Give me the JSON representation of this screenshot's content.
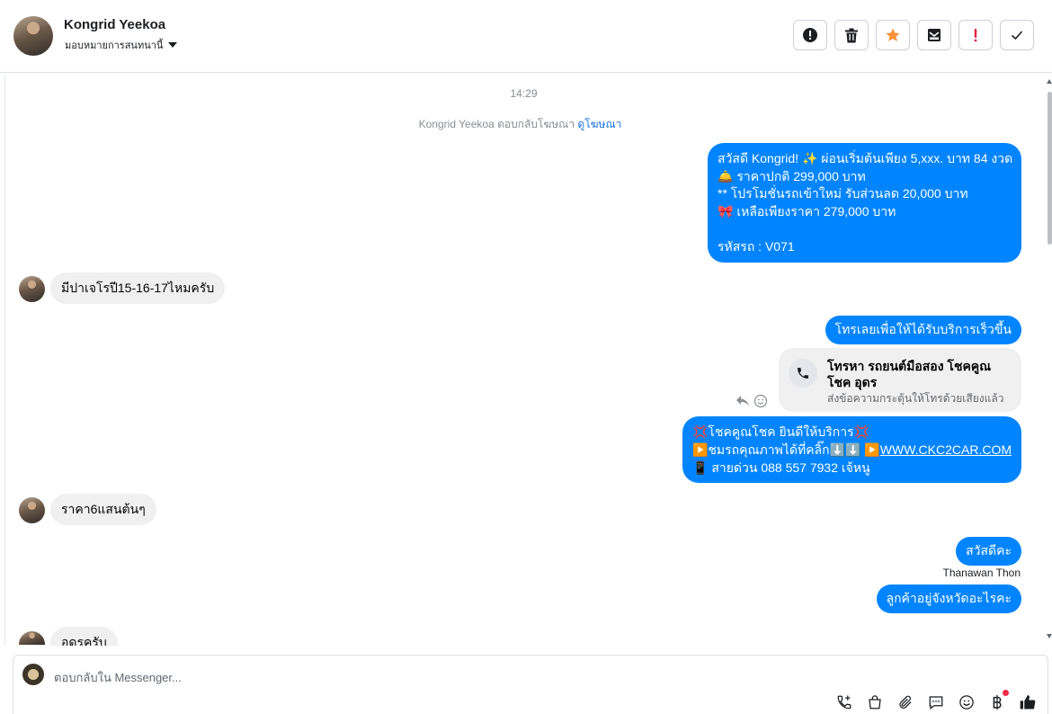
{
  "header": {
    "contact_name": "Kongrid Yeekoa",
    "assign_label": "มอบหมายการสนทนานี้",
    "colors": {
      "accent": "#0084ff",
      "star": "#f7923b",
      "danger": "#e41e3f"
    }
  },
  "actions": [
    {
      "name": "mark-spam-button",
      "icon": "alert-circle-icon"
    },
    {
      "name": "delete-button",
      "icon": "trash-icon"
    },
    {
      "name": "star-button",
      "icon": "star-icon"
    },
    {
      "name": "mark-unread-button",
      "icon": "envelope-icon"
    },
    {
      "name": "follow-up-button",
      "icon": "exclamation-icon"
    },
    {
      "name": "mark-done-button",
      "icon": "checkmark-icon"
    }
  ],
  "chat": {
    "time": "14:29",
    "reply_note_prefix": "Kongrid Yeekoa ตอบกลับโฆษณา",
    "reply_note_link": "ดูโฆษณา",
    "messages": {
      "out1": {
        "line1": "สวัสดี Kongrid! ✨  ผ่อนเริ่มต้นเพียง 5,xxx. บาท 84 งวด",
        "line2": "🛎️ ราคาปกติ 299,000 บาท",
        "line3": "** โปรโมชั่นรถเข้าใหม่ รับส่วนลด 20,000 บาท",
        "line4": "🎀  เหลือเพียงราคา 279,000 บาท",
        "line5": " รหัสรถ : V071"
      },
      "in1": "มีปาเจโรปี15-16-17ไหมครับ",
      "out2": "โทรเลยเพื่อให้ได้รับบริการเร็วขึ้น",
      "call_card": {
        "title": "โทรหา รถยนต์มือสอง โชคคูณ โชค อุดร",
        "subtitle": "ส่งข้อความกระตุ้นให้โทรด้วยเสียงแล้ว"
      },
      "out3": {
        "line1": "💢โชคคูณโชค ยินดีให้บริการ💢",
        "line2": "▶️ชมรถคุณภาพได้ที่คลิ๊ก⬇️⬇️      ▶️",
        "link": "WWW.CKC2CAR.COM",
        "line3": "📱 สายด่วน 088 557 7932 เจ้หนู"
      },
      "in2": "ราคา6แสนต้นๆ",
      "out4": "สวัสดีคะ",
      "sender_name": "Thanawan Thon",
      "out5": "ลูกค้าอยู่จังหวัดอะไรคะ",
      "in3": "อุดรครับ"
    }
  },
  "composer": {
    "placeholder": "ตอบกลับใน Messenger...",
    "tools": [
      "call-add-icon",
      "shopping-bag-icon",
      "paperclip-icon",
      "saved-reply-icon",
      "emoji-icon",
      "baht-icon",
      "like-icon"
    ]
  }
}
